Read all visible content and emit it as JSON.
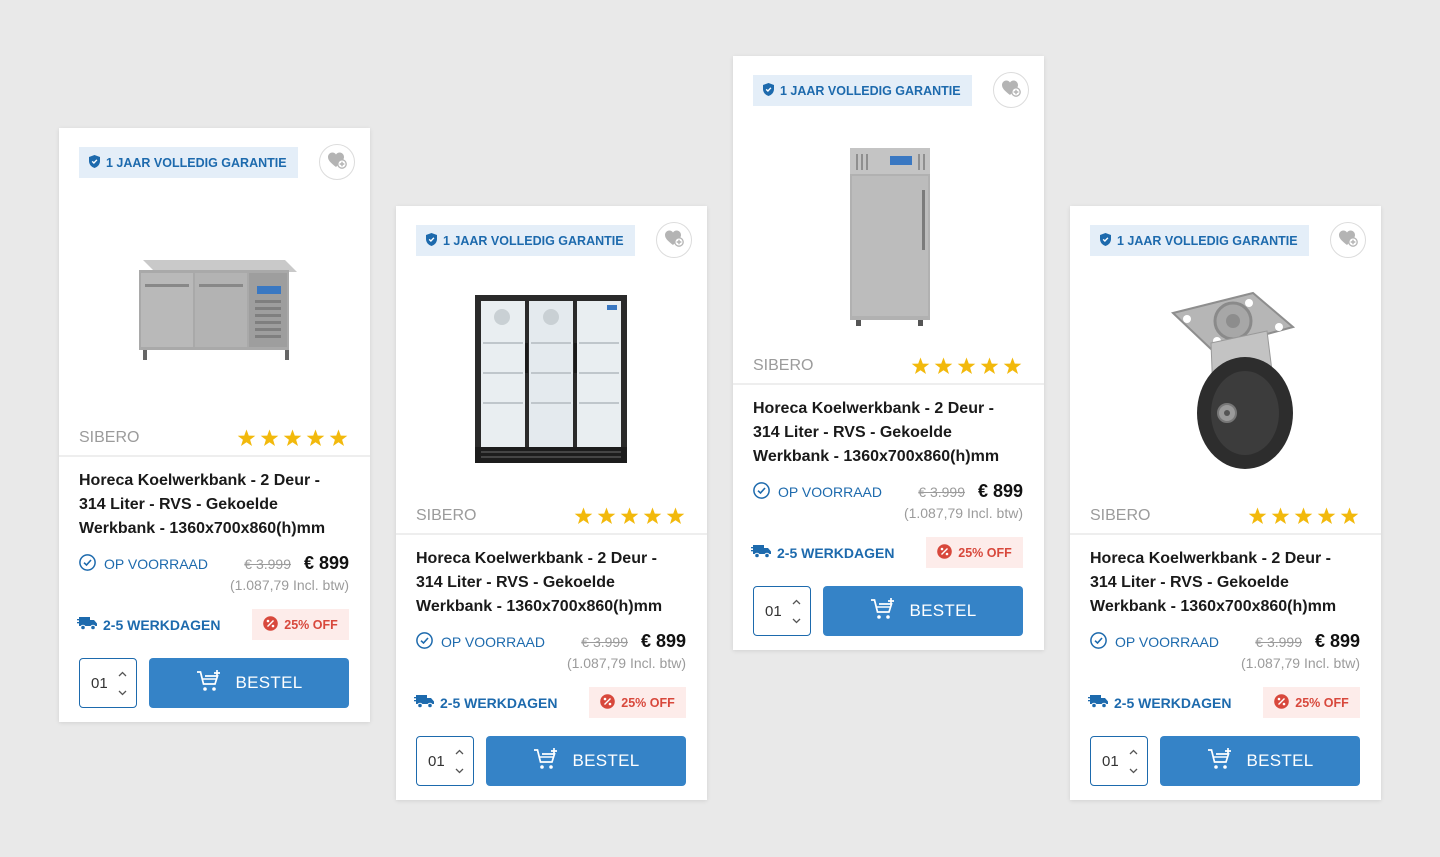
{
  "accent_color": "#3583c7",
  "badge_color": "#1d6aad",
  "discount_color": "#d8483c",
  "rating_color": "#f2b90c",
  "cards": [
    {
      "guarantee": "1 JAAR VOLLEDIG GARANTIE",
      "image": "stainless-steel-counter-fridge",
      "brand": "SIBERO",
      "rating": 5,
      "title": "Horeca Koelwerkbank - 2 Deur - 314 Liter - RVS - Gekoelde Werkbank - 1360x700x860(h)mm",
      "stock": "OP VOORRAAD",
      "old_price": "€ 3.999",
      "price": "€ 899",
      "vat": "(1.087,79 Incl. btw)",
      "delivery": "2-5 WERKDAGEN",
      "discount": "25% OFF",
      "quantity": "01",
      "button": "BESTEL"
    },
    {
      "guarantee": "1 JAAR VOLLEDIG GARANTIE",
      "image": "black-three-door-display-fridge",
      "brand": "SIBERO",
      "rating": 5,
      "title": "Horeca Koelwerkbank - 2 Deur - 314 Liter - RVS - Gekoelde Werkbank - 1360x700x860(h)mm",
      "stock": "OP VOORRAAD",
      "old_price": "€ 3.999",
      "price": "€ 899",
      "vat": "(1.087,79 Incl. btw)",
      "delivery": "2-5 WERKDAGEN",
      "discount": "25% OFF",
      "quantity": "01",
      "button": "BESTEL"
    },
    {
      "guarantee": "1 JAAR VOLLEDIG GARANTIE",
      "image": "stainless-steel-upright-fridge",
      "brand": "SIBERO",
      "rating": 5,
      "title": "Horeca Koelwerkbank - 2 Deur - 314 Liter - RVS - Gekoelde Werkbank - 1360x700x860(h)mm",
      "stock": "OP VOORRAAD",
      "old_price": "€ 3.999",
      "price": "€ 899",
      "vat": "(1.087,79 Incl. btw)",
      "delivery": "2-5 WERKDAGEN",
      "discount": "25% OFF",
      "quantity": "01",
      "button": "BESTEL"
    },
    {
      "guarantee": "1 JAAR VOLLEDIG GARANTIE",
      "image": "swivel-caster-wheel",
      "brand": "SIBERO",
      "rating": 5,
      "title": "Horeca Koelwerkbank - 2 Deur - 314 Liter - RVS - Gekoelde Werkbank - 1360x700x860(h)mm",
      "stock": "OP VOORRAAD",
      "old_price": "€ 3.999",
      "price": "€ 899",
      "vat": "(1.087,79 Incl. btw)",
      "delivery": "2-5 WERKDAGEN",
      "discount": "25% OFF",
      "quantity": "01",
      "button": "BESTEL"
    }
  ]
}
